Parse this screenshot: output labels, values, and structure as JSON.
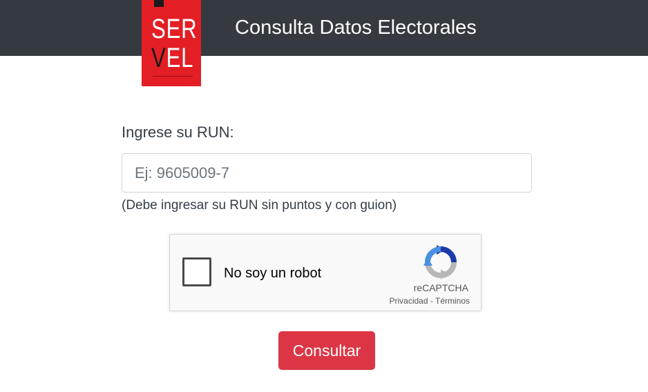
{
  "header": {
    "title": "Consulta Datos Electorales",
    "background_color": "#343a40"
  },
  "logo": {
    "line1": "SER",
    "line2_first": "V",
    "line2_rest": "EL",
    "color": "#e31e24"
  },
  "form": {
    "run_label": "Ingrese su RUN:",
    "run_placeholder": "Ej: 9605009-7",
    "run_value": "",
    "run_help": "(Debe ingresar su RUN sin puntos y con guion)"
  },
  "captcha": {
    "checkbox_label": "No soy un robot",
    "brand": "reCAPTCHA",
    "privacy_link": "Privacidad",
    "separator": " - ",
    "terms_link": "Términos",
    "icon": "recaptcha-logo-icon"
  },
  "submit": {
    "label": "Consultar",
    "color": "#dc3545"
  }
}
